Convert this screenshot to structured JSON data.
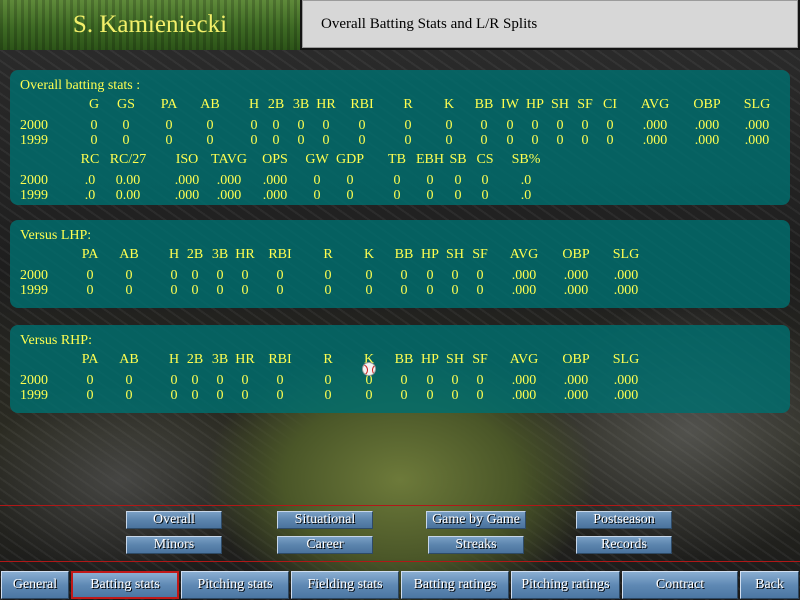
{
  "header": {
    "player_name": "S. Kamieniecki",
    "page_title": "Overall Batting Stats and L/R Splits"
  },
  "overall": {
    "title": "Overall batting stats :",
    "headers1": [
      "G",
      "GS",
      "PA",
      "AB",
      "H",
      "2B",
      "3B",
      "HR",
      "RBI",
      "R",
      "K",
      "BB",
      "IW",
      "HP",
      "SH",
      "SF",
      "CI",
      "AVG",
      "OBP",
      "SLG"
    ],
    "rows1": [
      {
        "year": "2000",
        "values": [
          "0",
          "0",
          "0",
          "0",
          "0",
          "0",
          "0",
          "0",
          "0",
          "0",
          "0",
          "0",
          "0",
          "0",
          "0",
          "0",
          "0",
          ".000",
          ".000",
          ".000"
        ]
      },
      {
        "year": "1999",
        "values": [
          "0",
          "0",
          "0",
          "0",
          "0",
          "0",
          "0",
          "0",
          "0",
          "0",
          "0",
          "0",
          "0",
          "0",
          "0",
          "0",
          "0",
          ".000",
          ".000",
          ".000"
        ]
      }
    ],
    "headers2": [
      "RC",
      "RC/27",
      "ISO",
      "TAVG",
      "OPS",
      "GW",
      "GDP",
      "TB",
      "EBH",
      "SB",
      "CS",
      "SB%"
    ],
    "rows2": [
      {
        "year": "2000",
        "values": [
          ".0",
          "0.00",
          ".000",
          ".000",
          ".000",
          "0",
          "0",
          "0",
          "0",
          "0",
          "0",
          ".0"
        ]
      },
      {
        "year": "1999",
        "values": [
          ".0",
          "0.00",
          ".000",
          ".000",
          ".000",
          "0",
          "0",
          "0",
          "0",
          "0",
          "0",
          ".0"
        ]
      }
    ]
  },
  "vs_lhp": {
    "title": "Versus LHP:",
    "headers": [
      "PA",
      "AB",
      "H",
      "2B",
      "3B",
      "HR",
      "RBI",
      "R",
      "K",
      "BB",
      "HP",
      "SH",
      "SF",
      "AVG",
      "OBP",
      "SLG"
    ],
    "rows": [
      {
        "year": "2000",
        "values": [
          "0",
          "0",
          "0",
          "0",
          "0",
          "0",
          "0",
          "0",
          "0",
          "0",
          "0",
          "0",
          "0",
          ".000",
          ".000",
          ".000"
        ]
      },
      {
        "year": "1999",
        "values": [
          "0",
          "0",
          "0",
          "0",
          "0",
          "0",
          "0",
          "0",
          "0",
          "0",
          "0",
          "0",
          "0",
          ".000",
          ".000",
          ".000"
        ]
      }
    ]
  },
  "vs_rhp": {
    "title": "Versus RHP:",
    "headers": [
      "PA",
      "AB",
      "H",
      "2B",
      "3B",
      "HR",
      "RBI",
      "R",
      "K",
      "BB",
      "HP",
      "SH",
      "SF",
      "AVG",
      "OBP",
      "SLG"
    ],
    "rows": [
      {
        "year": "2000",
        "values": [
          "0",
          "0",
          "0",
          "0",
          "0",
          "0",
          "0",
          "0",
          "0",
          "0",
          "0",
          "0",
          "0",
          ".000",
          ".000",
          ".000"
        ]
      },
      {
        "year": "1999",
        "values": [
          "0",
          "0",
          "0",
          "0",
          "0",
          "0",
          "0",
          "0",
          "0",
          "0",
          "0",
          "0",
          "0",
          ".000",
          ".000",
          ".000"
        ]
      }
    ]
  },
  "sub_nav": {
    "overall": "Overall",
    "situational": "Situational",
    "game_by_game": "Game by Game",
    "postseason": "Postseason",
    "minors": "Minors",
    "career": "Career",
    "streaks": "Streaks",
    "records": "Records"
  },
  "tabs": {
    "general": "General",
    "batting_stats": "Batting stats",
    "pitching_stats": "Pitching stats",
    "fielding_stats": "Fielding stats",
    "batting_ratings": "Batting ratings",
    "pitching_ratings": "Pitching ratings",
    "contract": "Contract",
    "back": "Back"
  },
  "colors": {
    "stat_text": "#ffff50",
    "panel": "#006e6e",
    "active_tab_border": "#c11818"
  }
}
